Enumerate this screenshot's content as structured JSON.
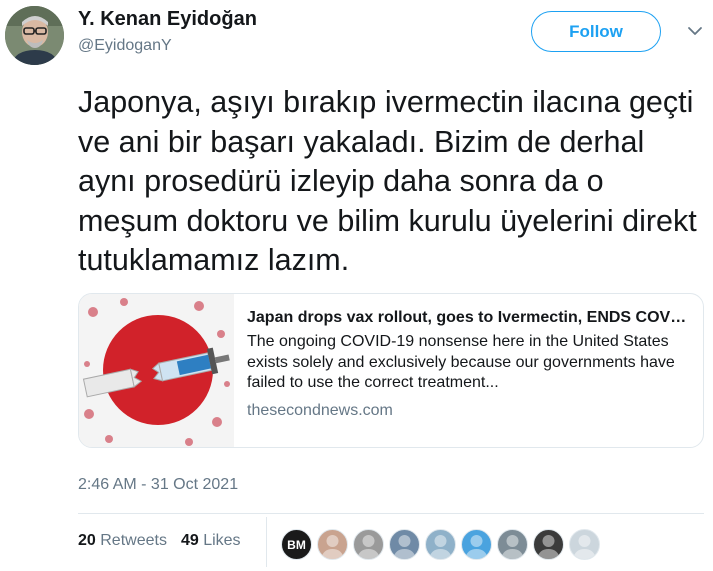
{
  "author": {
    "name": "Y. Kenan Eyidoğan",
    "handle": "@EyidoganY",
    "avatar_icon": "profile-photo"
  },
  "follow_label": "Follow",
  "tweet": {
    "text": "Japonya, aşıyı bırakıp ivermectin ilacına geçti ve ani bir başarı yakaladı. Bizim de derhal aynı prosedürü izleyip daha sonra da o meşum doktoru ve bilim kurulu üyelerini direkt tutuklamamız lazım."
  },
  "card": {
    "title": "Japan drops vax rollout, goes to Ivermectin, ENDS COVID almost overnight",
    "description": "The ongoing COVID-19 nonsense here in the United States exists solely and exclusively because our governments have failed to use the correct treatment...",
    "domain": "thesecondnews.com",
    "image_icon": "japan-flag-syringe-image"
  },
  "timestamp": "2:46 AM - 31 Oct 2021",
  "stats": {
    "retweets_count": "20",
    "retweets_label": "Retweets",
    "likes_count": "49",
    "likes_label": "Likes"
  },
  "likers": [
    {
      "initials": "BM",
      "color": "#1a1a1a"
    },
    {
      "initials": "",
      "color": "#c9a38f"
    },
    {
      "initials": "",
      "color": "#9a9a9a"
    },
    {
      "initials": "",
      "color": "#6f8aa6"
    },
    {
      "initials": "",
      "color": "#8fb1c9"
    },
    {
      "initials": "",
      "color": "#4aa3df"
    },
    {
      "initials": "",
      "color": "#7d8c96"
    },
    {
      "initials": "",
      "color": "#3b3b3b"
    },
    {
      "initials": "",
      "color": "#ccd6dd"
    }
  ],
  "colors": {
    "accent": "#1da1f2",
    "muted": "#657786",
    "border": "#e1e8ed"
  }
}
